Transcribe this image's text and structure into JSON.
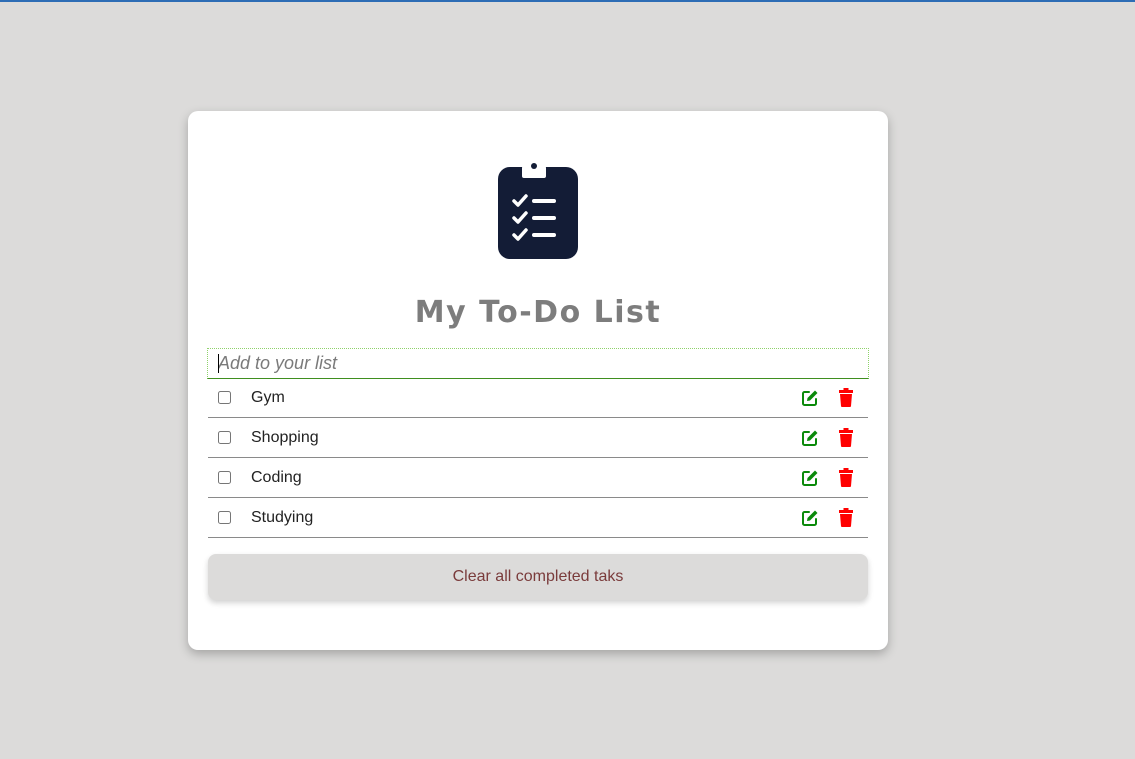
{
  "app": {
    "title": "My To-Do List"
  },
  "input": {
    "placeholder": "Add to your list",
    "value": ""
  },
  "tasks": [
    {
      "label": "Gym",
      "completed": false
    },
    {
      "label": "Shopping",
      "completed": false
    },
    {
      "label": "Coding",
      "completed": false
    },
    {
      "label": "Studying",
      "completed": false
    }
  ],
  "actions": {
    "clear_label": "Clear all completed taks"
  },
  "icons": {
    "logo": "clipboard-checklist-icon",
    "edit": "pen-to-square-icon",
    "delete": "trash-icon"
  },
  "colors": {
    "background": "#dcdbda",
    "card": "#ffffff",
    "logo": "#131c36",
    "title": "#7d7d7d",
    "edit": "#0a8a0a",
    "delete": "#ff0000",
    "clear_text": "#7a3b3b",
    "top_bar": "#2d6db5"
  }
}
